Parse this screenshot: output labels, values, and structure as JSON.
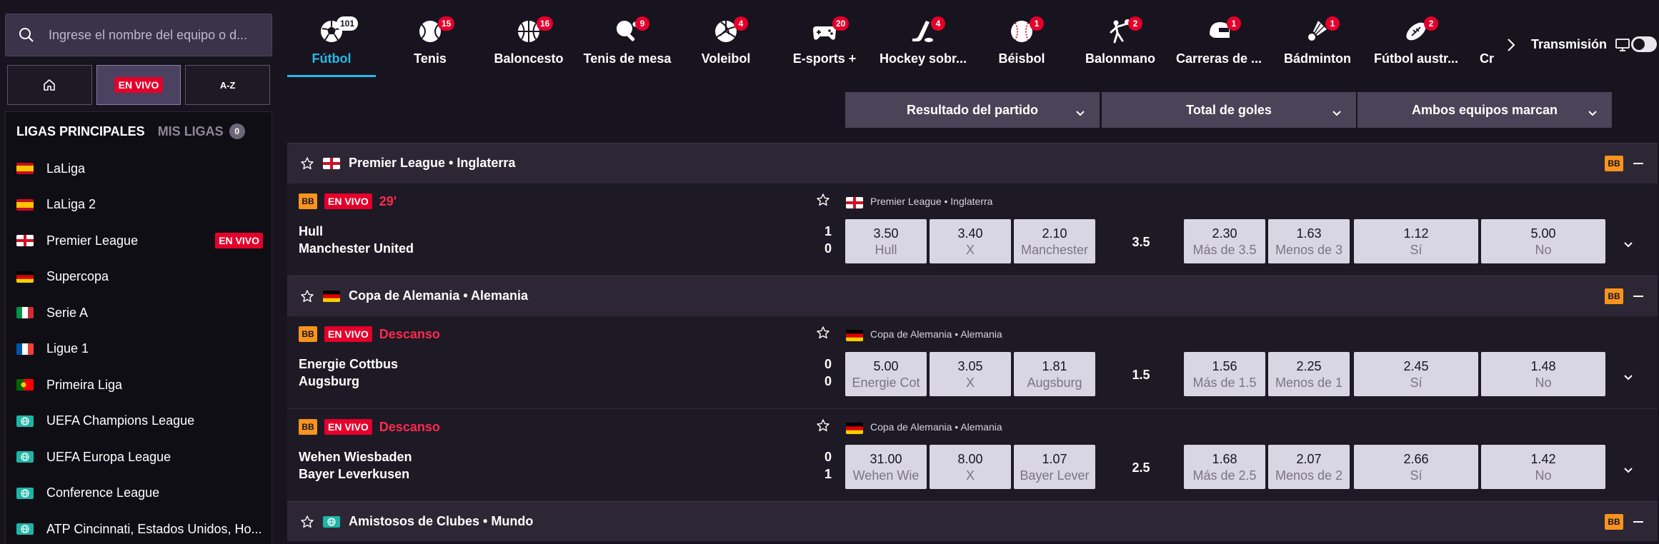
{
  "search": {
    "placeholder": "Ingrese el nombre del equipo o d..."
  },
  "modes": {
    "live_label": "EN VIVO",
    "az_label": "A-Z"
  },
  "leagues_panel": {
    "tab_main": "LIGAS PRINCIPALES",
    "tab_mine": "MIS LIGAS",
    "mine_count": "0",
    "items": [
      {
        "name": "LaLiga",
        "flag": "spain"
      },
      {
        "name": "LaLiga 2",
        "flag": "spain"
      },
      {
        "name": "Premier League",
        "flag": "england",
        "live": "EN VIVO"
      },
      {
        "name": "Supercopa",
        "flag": "germany"
      },
      {
        "name": "Serie A",
        "flag": "italy"
      },
      {
        "name": "Ligue 1",
        "flag": "france"
      },
      {
        "name": "Primeira Liga",
        "flag": "portugal"
      },
      {
        "name": "UEFA Champions League",
        "flag": "world"
      },
      {
        "name": "UEFA Europa League",
        "flag": "world"
      },
      {
        "name": "Conference League",
        "flag": "world"
      },
      {
        "name": "ATP Cincinnati, Estados Unidos, Ho...",
        "flag": "world"
      }
    ]
  },
  "sports": [
    {
      "label": "Fútbol",
      "count": "101",
      "icon": "soccer-ball-icon",
      "active": true
    },
    {
      "label": "Tenis",
      "count": "15",
      "icon": "tennis-ball-icon"
    },
    {
      "label": "Baloncesto",
      "count": "16",
      "icon": "basketball-icon"
    },
    {
      "label": "Tenis de mesa",
      "count": "9",
      "icon": "table-tennis-icon"
    },
    {
      "label": "Voleibol",
      "count": "4",
      "icon": "volleyball-icon"
    },
    {
      "label": "E-sports +",
      "count": "20",
      "icon": "gamepad-icon"
    },
    {
      "label": "Hockey sobr...",
      "count": "4",
      "icon": "hockey-icon"
    },
    {
      "label": "Béisbol",
      "count": "1",
      "icon": "baseball-icon"
    },
    {
      "label": "Balonmano",
      "count": "2",
      "icon": "handball-icon"
    },
    {
      "label": "Carreras de ...",
      "count": "1",
      "icon": "helmet-icon"
    },
    {
      "label": "Bádminton",
      "count": "1",
      "icon": "shuttlecock-icon"
    },
    {
      "label": "Fútbol austr...",
      "count": "2",
      "icon": "rugby-ball-icon"
    },
    {
      "label": "Cr",
      "count": "",
      "icon": ""
    }
  ],
  "header": {
    "transmision": "Transmisión"
  },
  "markets": [
    "Resultado del partido",
    "Total de goles",
    "Ambos equipos marcan"
  ],
  "bb_label": "BB",
  "groups": [
    {
      "name": "Premier League • Inglaterra",
      "flag": "england"
    },
    {
      "name": "Copa de Alemania • Alemania",
      "flag": "germany"
    },
    {
      "name": "Amistosos de Clubes • Mundo",
      "flag": "world"
    }
  ],
  "matches": [
    {
      "live": "EN VIVO",
      "status": "29'",
      "league": "Premier League • Inglaterra",
      "flag": "england",
      "home": "Hull",
      "away": "Manchester United",
      "home_score": "1",
      "away_score": "0",
      "odds_1x2": [
        {
          "v": "3.50",
          "l": "Hull"
        },
        {
          "v": "3.40",
          "l": "X"
        },
        {
          "v": "2.10",
          "l": "Manchester"
        }
      ],
      "total_line": "3.5",
      "odds_total": [
        {
          "v": "2.30",
          "l": "Más de 3.5"
        },
        {
          "v": "1.63",
          "l": "Menos de 3"
        }
      ],
      "odds_btts": [
        {
          "v": "1.12",
          "l": "Sí"
        },
        {
          "v": "5.00",
          "l": "No"
        }
      ]
    },
    {
      "live": "EN VIVO",
      "status": "Descanso",
      "league": "Copa de Alemania • Alemania",
      "flag": "germany",
      "home": "Energie Cottbus",
      "away": "Augsburg",
      "home_score": "0",
      "away_score": "0",
      "odds_1x2": [
        {
          "v": "5.00",
          "l": "Energie Cot"
        },
        {
          "v": "3.05",
          "l": "X"
        },
        {
          "v": "1.81",
          "l": "Augsburg"
        }
      ],
      "total_line": "1.5",
      "odds_total": [
        {
          "v": "1.56",
          "l": "Más de 1.5"
        },
        {
          "v": "2.25",
          "l": "Menos de 1"
        }
      ],
      "odds_btts": [
        {
          "v": "2.45",
          "l": "Sí"
        },
        {
          "v": "1.48",
          "l": "No"
        }
      ]
    },
    {
      "live": "EN VIVO",
      "status": "Descanso",
      "league": "Copa de Alemania • Alemania",
      "flag": "germany",
      "home": "Wehen Wiesbaden",
      "away": "Bayer Leverkusen",
      "home_score": "0",
      "away_score": "1",
      "odds_1x2": [
        {
          "v": "31.00",
          "l": "Wehen Wie"
        },
        {
          "v": "8.00",
          "l": "X"
        },
        {
          "v": "1.07",
          "l": "Bayer Lever"
        }
      ],
      "total_line": "2.5",
      "odds_total": [
        {
          "v": "1.68",
          "l": "Más de 2.5"
        },
        {
          "v": "2.07",
          "l": "Menos de 2"
        }
      ],
      "odds_btts": [
        {
          "v": "2.66",
          "l": "Sí"
        },
        {
          "v": "1.42",
          "l": "No"
        }
      ]
    }
  ],
  "colors": {
    "accent": "#27b9e6",
    "live": "#e4002b",
    "bb": "#f7931e",
    "odd_bg": "#d9d6e3"
  }
}
